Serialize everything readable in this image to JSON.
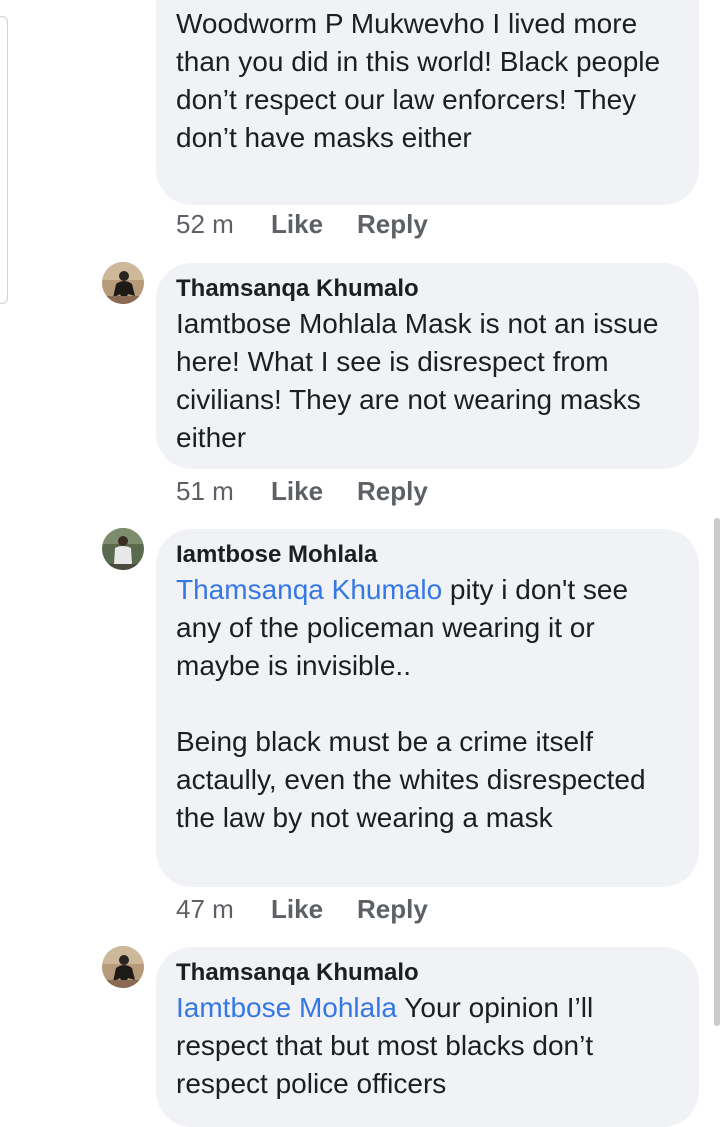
{
  "comments": [
    {
      "author": "",
      "text": "Woodworm P Mukwevho I lived more than you did in this world! Black people don’t respect our law enforcers! They don’t have masks either",
      "mention": "",
      "time": "52 m",
      "like": "Like",
      "reply": "Reply"
    },
    {
      "author": "Thamsanqa Khumalo",
      "mention": "",
      "text": "Iamtbose Mohlala Mask is not an issue here! What I see is disrespect from civilians! They are not wearing masks either",
      "time": "51 m",
      "like": "Like",
      "reply": "Reply"
    },
    {
      "author": "Iamtbose Mohlala",
      "mention": "Thamsanqa Khumalo",
      "text": " pity i don't see any of the policeman wearing it or maybe is invisible..\n\nBeing black must be a crime itself actaully, even the whites disrespected the law by not wearing a mask",
      "time": "47 m",
      "like": "Like",
      "reply": "Reply"
    },
    {
      "author": "Thamsanqa Khumalo",
      "mention": "Iamtbose Mohlala",
      "text": " Your opinion I’ll respect that but most blacks don’t respect police officers",
      "time": "",
      "like": "",
      "reply": ""
    }
  ],
  "colors": {
    "bubble": "#f0f2f5",
    "mention": "#3578e5",
    "meta": "#5d6166"
  }
}
